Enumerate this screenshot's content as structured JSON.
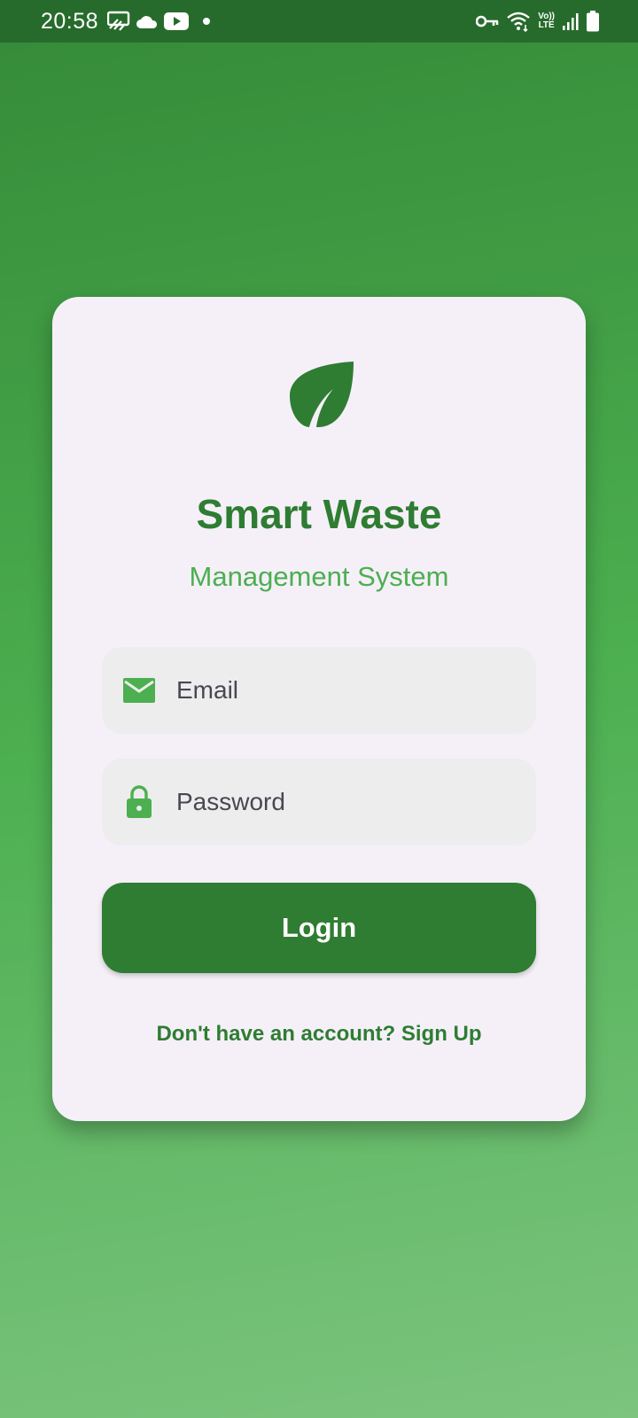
{
  "status_bar": {
    "time": "20:58",
    "volte_top": "Vo))",
    "volte_bottom": "LTE",
    "left_icons": [
      "cast-icon",
      "cloud-icon",
      "youtube-icon",
      "notification-dot"
    ],
    "right_icons": [
      "vpn-key-icon",
      "wifi-icon",
      "volte-icon",
      "signal-icon",
      "battery-icon"
    ]
  },
  "app": {
    "logo_icon": "leaf-icon",
    "title": "Smart Waste",
    "subtitle": "Management System"
  },
  "form": {
    "email_placeholder": "Email",
    "email_value": "",
    "email_icon": "mail-icon",
    "password_placeholder": "Password",
    "password_value": "",
    "password_icon": "lock-icon",
    "login_label": "Login",
    "signup_text": "Don't have an account? Sign Up"
  },
  "colors": {
    "primary": "#2e7d32",
    "accent": "#4caf50",
    "status_bar": "#276b2c",
    "card": "#f5f0f8",
    "field": "#ededed"
  }
}
